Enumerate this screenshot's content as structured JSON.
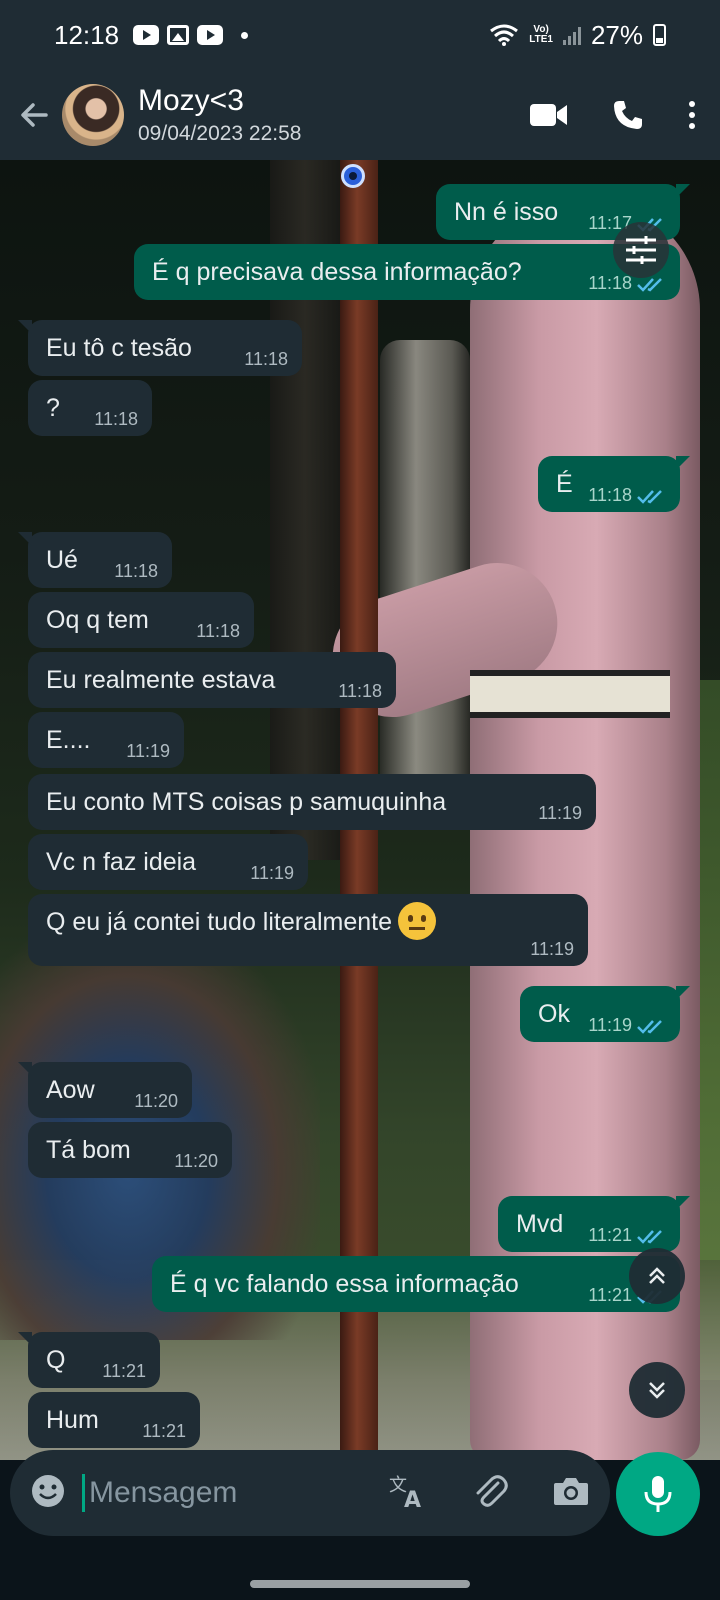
{
  "status_bar": {
    "time": "12:18",
    "volte_top": "Vo)",
    "volte_bottom": "LTE1",
    "battery": "27%"
  },
  "header": {
    "contact_name": "Mozy<3",
    "subtitle": "09/04/2023 22:58",
    "icons": [
      "back-arrow-icon",
      "video-call-icon",
      "voice-call-icon",
      "more-options-icon"
    ]
  },
  "messages": [
    {
      "dir": "out",
      "text": "Nn é isso",
      "time": "11:17"
    },
    {
      "dir": "out",
      "text": "É q precisava dessa informação?",
      "time": "11:18"
    },
    {
      "dir": "in",
      "text": "Eu tô c tesão",
      "time": "11:18"
    },
    {
      "dir": "in",
      "text": "?",
      "time": "11:18"
    },
    {
      "dir": "out",
      "text": "É",
      "time": "11:18"
    },
    {
      "dir": "in",
      "text": "Ué",
      "time": "11:18"
    },
    {
      "dir": "in",
      "text": "Oq q tem",
      "time": "11:18"
    },
    {
      "dir": "in",
      "text": "Eu realmente estava",
      "time": "11:18"
    },
    {
      "dir": "in",
      "text": "E....",
      "time": "11:19"
    },
    {
      "dir": "in",
      "text": "Eu conto MTS coisas p samuquinha",
      "time": "11:19"
    },
    {
      "dir": "in",
      "text": "Vc n faz ideia",
      "time": "11:19"
    },
    {
      "dir": "in",
      "text": "Q eu já contei tudo literalmente",
      "time": "11:19",
      "emoji": "neutral-face"
    },
    {
      "dir": "out",
      "text": "Ok",
      "time": "11:19"
    },
    {
      "dir": "in",
      "text": "Aow",
      "time": "11:20"
    },
    {
      "dir": "in",
      "text": "Tá bom",
      "time": "11:20"
    },
    {
      "dir": "out",
      "text": "Mvd",
      "time": "11:21"
    },
    {
      "dir": "out",
      "text": "É q vc falando essa informação",
      "time": "11:21"
    },
    {
      "dir": "in",
      "text": "Q",
      "time": "11:21"
    },
    {
      "dir": "in",
      "text": "Hum",
      "time": "11:21"
    }
  ],
  "input": {
    "placeholder": "Mensagem",
    "icons": [
      "emoji-icon",
      "translate-icon",
      "attach-icon",
      "camera-icon",
      "mic-icon"
    ]
  },
  "colors": {
    "header_bg": "#1f2c34",
    "incoming_bubble": "#1f2c34",
    "outgoing_bubble": "#005c4b",
    "accent": "#00a884",
    "read_tick": "#53bdeb"
  }
}
